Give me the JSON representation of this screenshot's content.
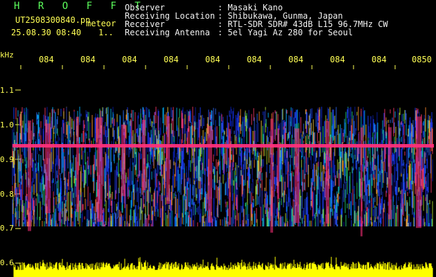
{
  "header": {
    "title": "H R O F F T",
    "filename": "UT2508300840.pn",
    "meteor_label": "meteor",
    "datetime": "25.08.30 08:40",
    "counter": "1..",
    "info_labels": [
      "Observer",
      "Receiving Location",
      "Receiver",
      "Receiving Antenna"
    ],
    "info_values": [
      ": Masaki Kano",
      ": Shibukawa, Gunma, Japan",
      ": RTL-SDR SDR# 43dB L15 96.7MHz CW",
      ": 5el Yagi Az 280 for Seoul"
    ]
  },
  "axis": {
    "unit": "kHz",
    "y_ticks": [
      "1.1",
      "1.0",
      "0.9",
      "0.8",
      "0.7",
      "0.6"
    ],
    "x_ticks": [
      "084",
      "084",
      "084",
      "084",
      "084",
      "084",
      "084",
      "084",
      "084",
      "0850"
    ]
  },
  "colors": {
    "background": "#000000",
    "carrier": "#ff2f7a",
    "level_bars": "#ffff00"
  }
}
